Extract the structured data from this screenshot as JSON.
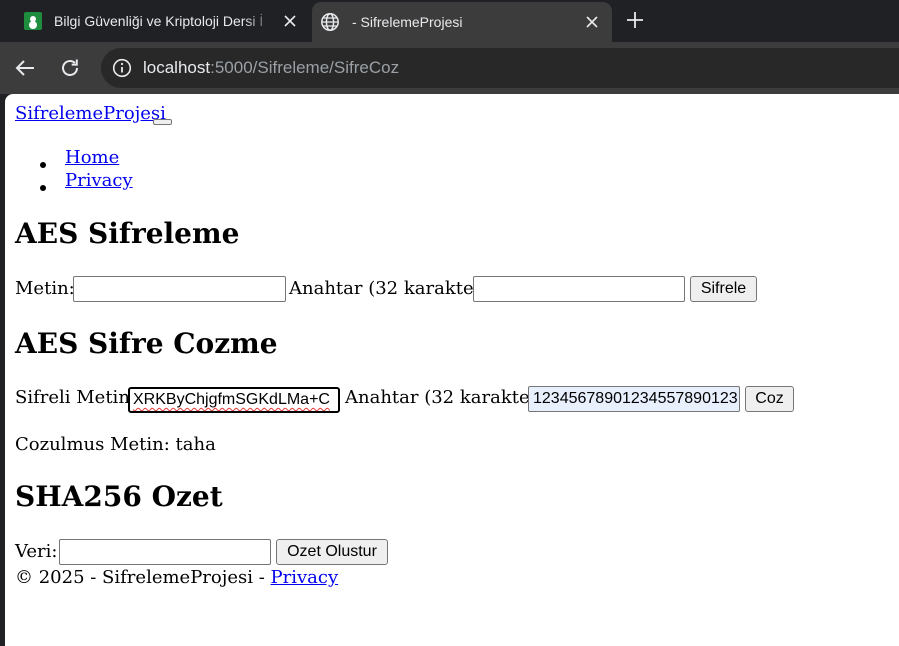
{
  "browser": {
    "tabs": [
      {
        "title": "Bilgi Güvenliği ve Kriptoloji Dersi İ",
        "favicon": "classroom-icon",
        "active": false
      },
      {
        "title": "- SifrelemeProjesi",
        "favicon": "globe-icon",
        "active": true
      }
    ],
    "url_host": "localhost",
    "url_path": ":5000/Sifreleme/SifreCoz"
  },
  "page": {
    "brand": "SifrelemeProjesi",
    "nav": [
      "Home",
      "Privacy"
    ],
    "encrypt": {
      "heading": "AES Sifreleme",
      "text_label": "Metin:",
      "text_value": "",
      "key_label": "Anahtar (32 karakter):",
      "key_value": "",
      "button": "Sifrele"
    },
    "decrypt": {
      "heading": "AES Sifre Cozme",
      "cipher_label": "Sifreli Metin:",
      "cipher_value": "XRKByChjgfmSGKdLMa+C",
      "key_label": "Anahtar (32 karakter):",
      "key_value": "12345678901234557890123",
      "button": "Coz",
      "result_label": "Cozulmus Metin:",
      "result_value": "taha"
    },
    "hash": {
      "heading": "SHA256 Ozet",
      "data_label": "Veri:",
      "data_value": "",
      "button": "Ozet Olustur"
    },
    "footer": {
      "copyright": "© 2025 - SifrelemeProjesi -",
      "privacy_link": "Privacy"
    }
  },
  "colors": {
    "chrome_dark": "#202124",
    "chrome_toolbar": "#3c3c3c",
    "link": "#0000ee",
    "autofill": "#e8f0fe"
  }
}
